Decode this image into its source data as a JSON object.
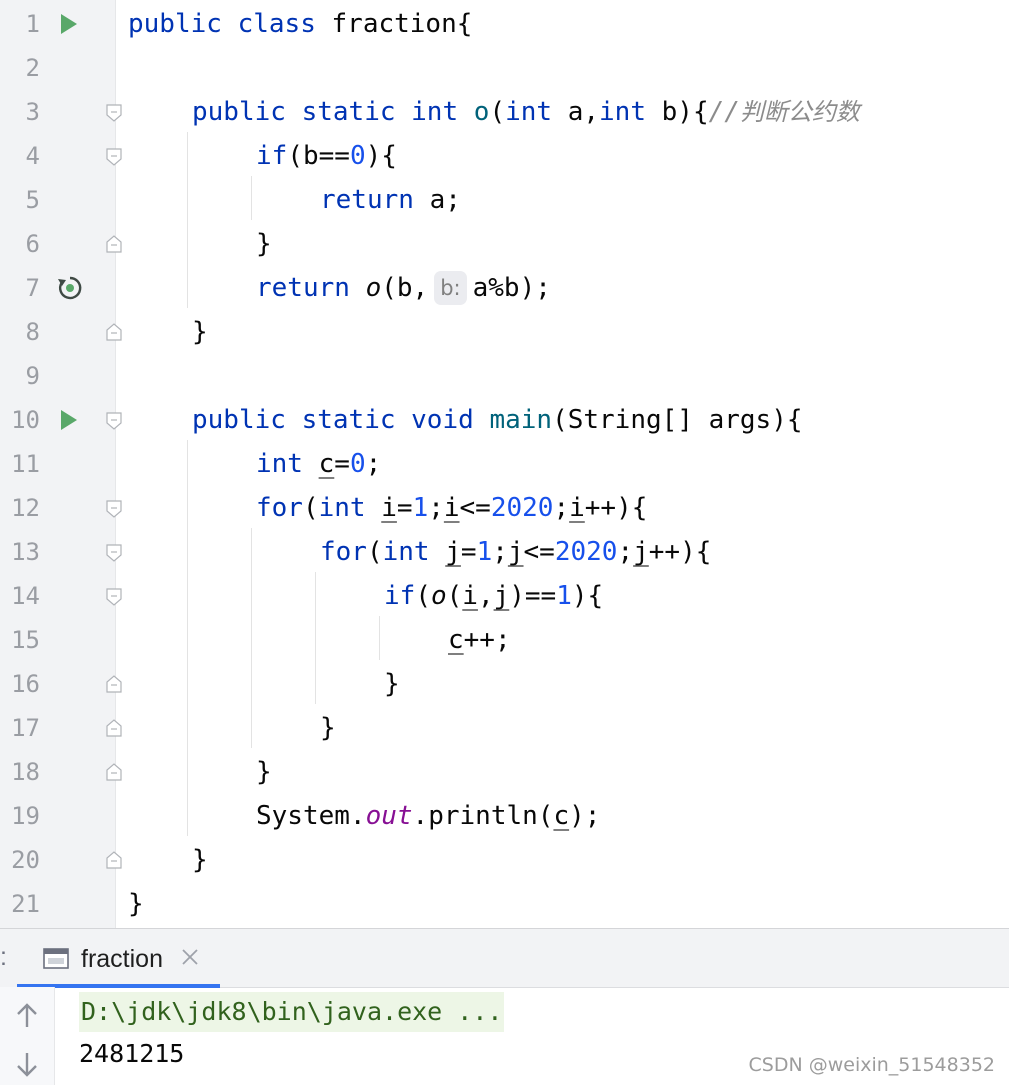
{
  "line_numbers": [
    "1",
    "2",
    "3",
    "4",
    "5",
    "6",
    "7",
    "8",
    "9",
    "10",
    "11",
    "12",
    "13",
    "14",
    "15",
    "16",
    "17",
    "18",
    "19",
    "20",
    "21"
  ],
  "code": {
    "l1": {
      "k1": "public",
      "s1": " ",
      "k2": "class",
      "t1": " fraction{"
    },
    "l3": {
      "k1": "public",
      "s1": " ",
      "k2": "static",
      "s2": " ",
      "k3": "int",
      "s3": " ",
      "m": "o",
      "t1": "(",
      "k4": "int",
      "t2": " a,",
      "k5": "int",
      "t3": " b){",
      "c1": "//",
      "c2": "判断公约数"
    },
    "l4": {
      "k1": "if",
      "t1": "(b==",
      "n1": "0",
      "t2": "){"
    },
    "l5": {
      "k1": "return",
      "t1": " a;"
    },
    "l6": {
      "t1": "}"
    },
    "l7": {
      "k1": "return",
      "s1": " ",
      "m": "o",
      "t1": "(b,",
      "hint": "b:",
      "t2": "a%b);"
    },
    "l8": {
      "t1": "}"
    },
    "l10": {
      "k1": "public",
      "s1": " ",
      "k2": "static",
      "s2": " ",
      "k3": "void",
      "s3": " ",
      "m": "main",
      "t1": "(String[] args){"
    },
    "l11": {
      "k1": "int",
      "s1": " ",
      "v1": "c",
      "t1": "=",
      "n1": "0",
      "t2": ";"
    },
    "l12": {
      "k1": "for",
      "t1": "(",
      "k2": "int",
      "s1": " ",
      "v1": "i",
      "t2": "=",
      "n1": "1",
      "t3": ";",
      "v2": "i",
      "t4": "<=",
      "n2": "2020",
      "t5": ";",
      "v3": "i",
      "t6": "++){"
    },
    "l13": {
      "k1": "for",
      "t1": "(",
      "k2": "int",
      "s1": " ",
      "v1": "j",
      "t2": "=",
      "n1": "1",
      "t3": ";",
      "v2": "j",
      "t4": "<=",
      "n2": "2020",
      "t5": ";",
      "v3": "j",
      "t6": "++){"
    },
    "l14": {
      "k1": "if",
      "t1": "(",
      "m": "o",
      "t2": "(",
      "v1": "i",
      "t3": ",",
      "v2": "j",
      "t4": ")==",
      "n1": "1",
      "t5": "){"
    },
    "l15": {
      "v1": "c",
      "t1": "++;"
    },
    "l16": {
      "t1": "}"
    },
    "l17": {
      "t1": "}"
    },
    "l18": {
      "t1": "}"
    },
    "l19": {
      "t1": "System.",
      "f1": "out",
      "t2": ".println(",
      "v1": "c",
      "t3": ");"
    },
    "l20": {
      "t1": "}"
    },
    "l21": {
      "t1": "}"
    }
  },
  "run_panel": {
    "panel_label": ":",
    "tab_label": "fraction",
    "command_line": "D:\\jdk\\jdk8\\bin\\java.exe ...",
    "output_line": "2481215"
  },
  "watermark": "CSDN @weixin_51548352",
  "icons": {
    "run": "run-gutter-icon",
    "recursive": "recursive-call-icon",
    "fold": "fold-marker-icon",
    "tab": "console-tab-icon",
    "close": "close-icon",
    "up": "arrow-up-icon",
    "down": "arrow-down-icon"
  },
  "colors": {
    "keyword": "#0033b3",
    "number": "#1750eb",
    "method": "#00627a",
    "field": "#871094",
    "comment": "#8c8c8c",
    "run_green": "#59a869",
    "tab_accent": "#3574f0",
    "command_bg": "#edf6e6",
    "command_fg": "#31621d"
  }
}
